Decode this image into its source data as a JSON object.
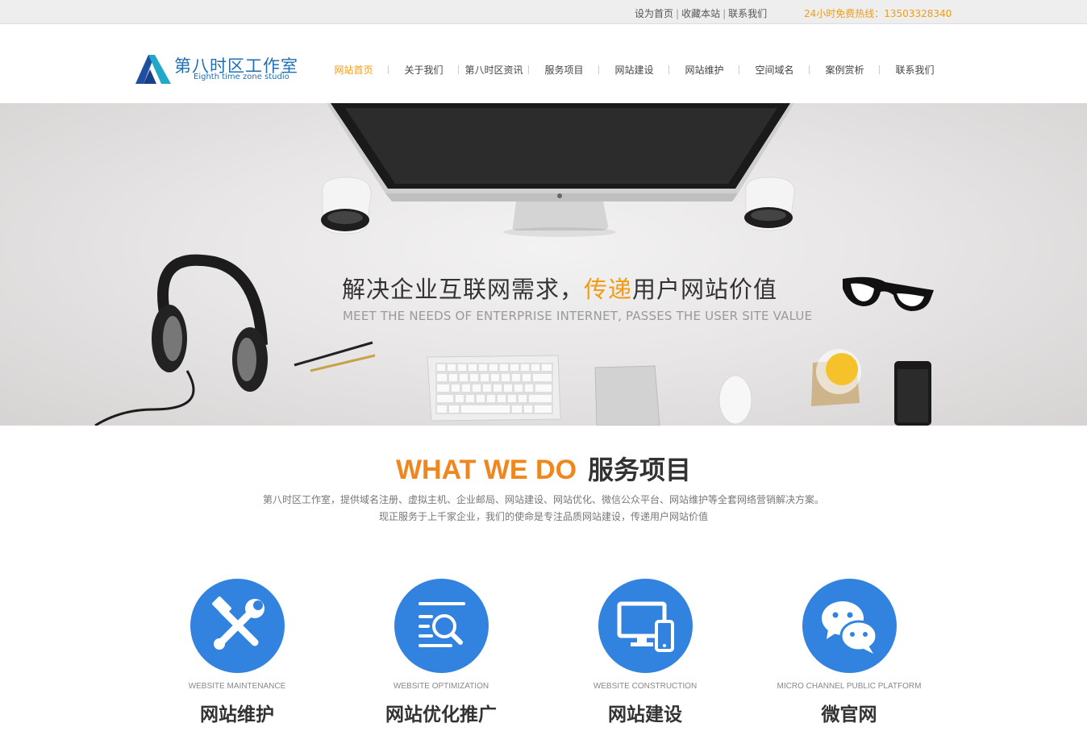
{
  "topbar": {
    "links": [
      "设为首页",
      "收藏本站",
      "联系我们"
    ],
    "hotline": "24小时免费热线：13503328340"
  },
  "logo": {
    "cn": "第八时区工作室",
    "en": "Eighth time zone studio"
  },
  "nav": {
    "items": [
      "网站首页",
      "关于我们",
      "第八时区资讯",
      "服务项目",
      "网站建设",
      "网站维护",
      "空间域名",
      "案例赏析",
      "联系我们"
    ],
    "active": "网站首页"
  },
  "banner": {
    "headline_pre": "解决企业互联网需求，",
    "headline_highlight": "传递",
    "headline_post": "用户网站价值",
    "subline": "MEET THE NEEDS OF ENTERPRISE INTERNET, PASSES THE USER SITE VALUE"
  },
  "services": {
    "title_en": "WHAT WE DO",
    "title_cn": "服务项目",
    "desc_line1": "第八时区工作室，提供域名注册、虚拟主机、企业邮局、网站建设、网站优化、微信公众平台、网站维护等全套网络营销解决方案。",
    "desc_line2": "现正服务于上千家企业，我们的使命是专注品质网站建设，传递用户网站价值",
    "items": [
      {
        "en": "WEBSITE MAINTENANCE",
        "cn": "网站维护",
        "icon": "tools-icon"
      },
      {
        "en": "WEBSITE OPTIMIZATION",
        "cn": "网站优化推广",
        "icon": "search-document-icon"
      },
      {
        "en": "WEBSITE CONSTRUCTION",
        "cn": "网站建设",
        "icon": "devices-icon"
      },
      {
        "en": "MICRO CHANNEL PUBLIC PLATFORM",
        "cn": "微官网",
        "icon": "wechat-icon"
      }
    ]
  },
  "colors": {
    "accent_orange": "#f39c12",
    "service_blue": "#3283e0",
    "logo_blue": "#1f6fb5"
  }
}
